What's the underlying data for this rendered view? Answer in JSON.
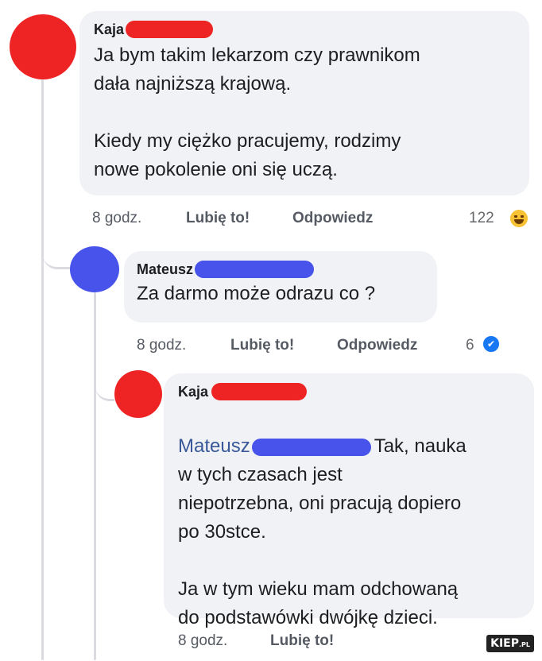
{
  "colors": {
    "avatar_kaja": "#ee2424",
    "avatar_mateusz": "#4753ea",
    "redaction_red": "#ee2424",
    "redaction_blue": "#4753ea",
    "bubble_bg": "#f0f2f5",
    "mention": "#385898"
  },
  "comment1": {
    "author": "Kaja",
    "text": "Ja bym takim lekarzom czy prawnikom\ndała najniższą krajową.\n\nKiedy my ciężko pracujemy, rodzimy\nnowe pokolenie oni się uczą.",
    "time": "8 godz.",
    "like_label": "Lubię to!",
    "reply_label": "Odpowiedz",
    "reaction_count": "122",
    "reaction_icon": "haha-emoji-icon"
  },
  "comment2": {
    "author": "Mateusz",
    "text": "Za darmo może odrazu co ?",
    "time": "8 godz.",
    "like_label": "Lubię to!",
    "reply_label": "Odpowiedz",
    "reaction_count": "6",
    "reaction_icon": "like-thumb-icon"
  },
  "comment3": {
    "author": "Kaja",
    "mention": "Mateusz",
    "text_first": "Tak, nauka",
    "text_rest": "w tych czasach jest\nniepotrzebna, oni pracują dopiero\npo 30stce.\n\nJa w tym wieku mam odchowaną\ndo podstawówki dwójkę dzieci.",
    "time": "8 godz.",
    "like_label": "Lubię to!"
  },
  "watermark": {
    "main": "KIEP",
    "suffix": ".PL"
  }
}
